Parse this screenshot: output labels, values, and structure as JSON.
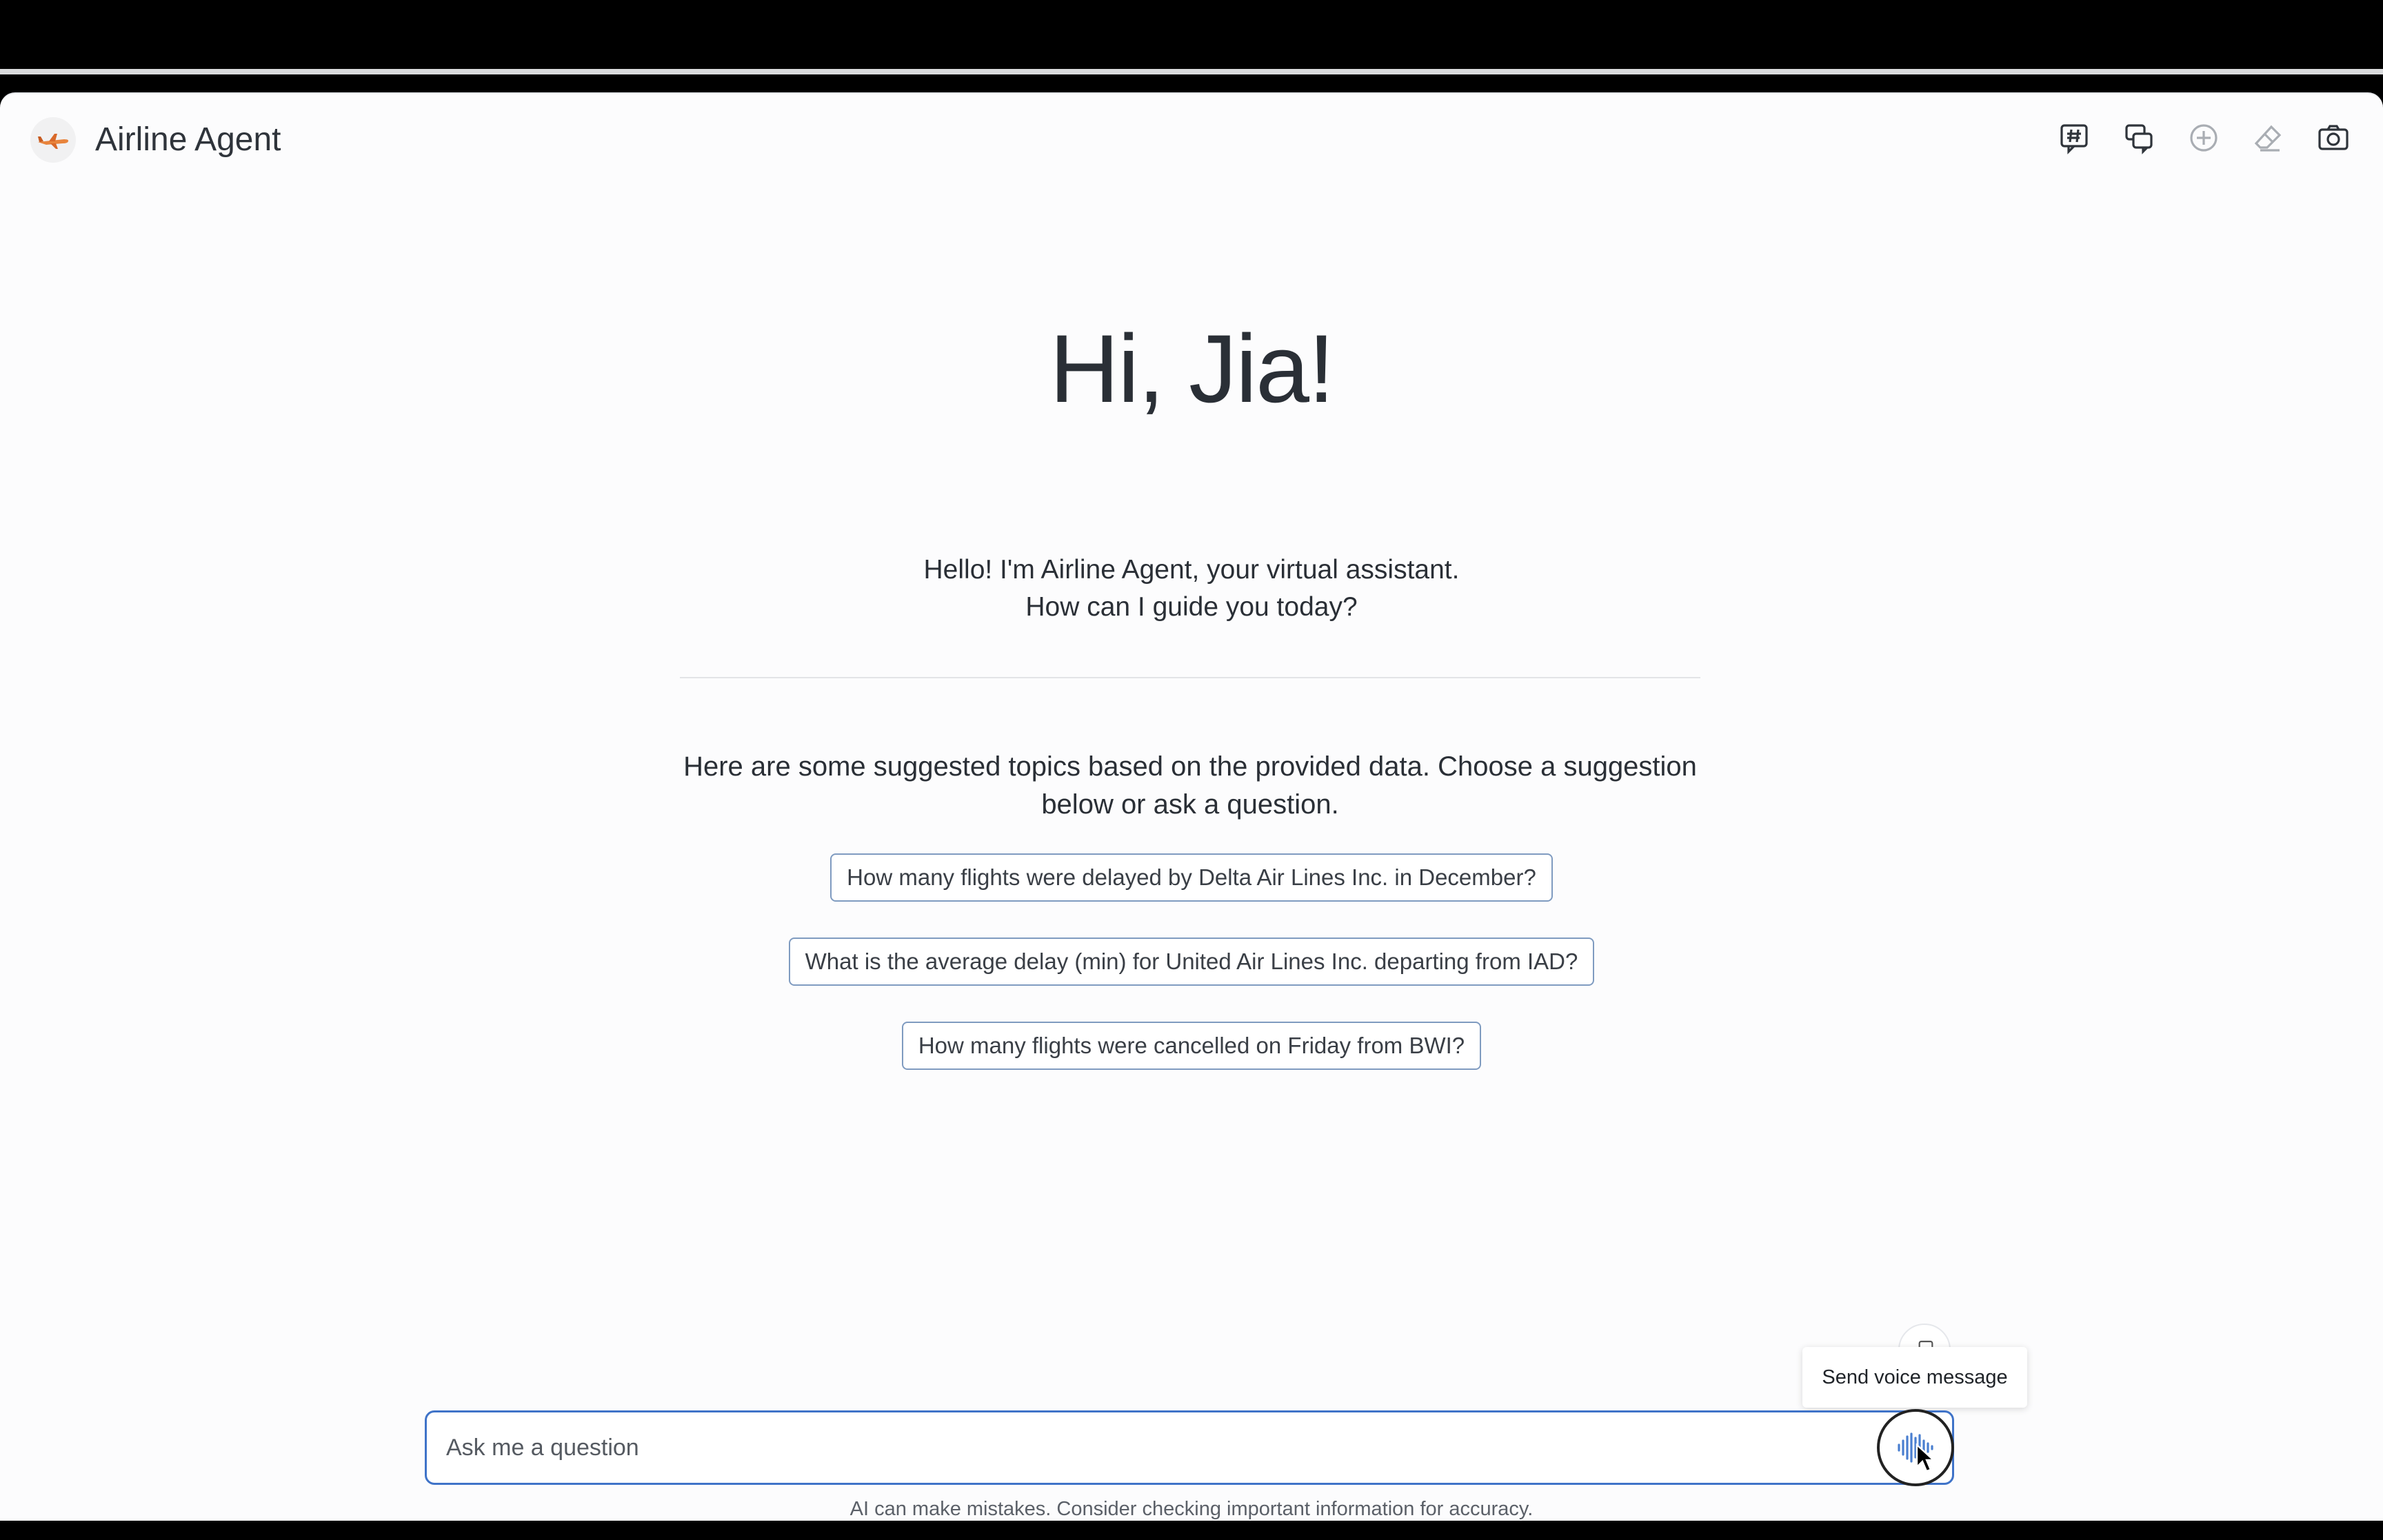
{
  "app": {
    "title": "Airline Agent",
    "logo_icon": "airplane-icon"
  },
  "header": {
    "icons": [
      "chat-hash-icon",
      "chat-history-icon",
      "add-circle-icon",
      "eraser-icon",
      "camera-icon"
    ]
  },
  "welcome": {
    "greeting": "Hi, Jia!",
    "intro_line1": "Hello! I'm Airline Agent, your virtual assistant.",
    "intro_line2": "How can I guide you today?"
  },
  "suggestions": {
    "intro": "Here are some suggested topics based on the provided data. Choose a suggestion below or ask a question.",
    "items": [
      "How many flights were delayed by Delta Air Lines Inc. in December?",
      "What is the average delay (min) for United Air Lines Inc. departing from IAD?",
      "How many flights were cancelled on Friday from BWI?"
    ]
  },
  "composer": {
    "placeholder": "Ask me a question",
    "value": "",
    "voice_icon": "voice-wave-icon",
    "tooltip": "Send voice message"
  },
  "footer": {
    "disclaimer": "AI can make mistakes. Consider checking important information for accuracy."
  },
  "colors": {
    "accent_border": "#3f73c8",
    "chip_border": "#7f9bc0",
    "text": "#2a2f36"
  }
}
